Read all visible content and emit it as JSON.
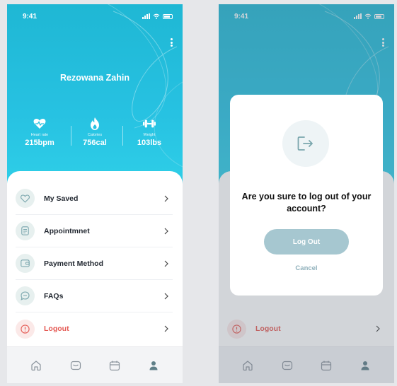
{
  "status": {
    "time": "9:41"
  },
  "profile": {
    "name": "Rezowana Zahin",
    "stats": [
      {
        "icon": "heart-rate-icon",
        "label": "Heart rate",
        "value": "215bpm"
      },
      {
        "icon": "calories-flame-icon",
        "label": "Calories",
        "value": "756cal"
      },
      {
        "icon": "dumbbell-icon",
        "label": "Weight",
        "value": "103lbs"
      }
    ]
  },
  "menu": {
    "items": [
      {
        "id": "my-saved",
        "label": "My Saved",
        "icon": "heart-icon"
      },
      {
        "id": "appointment",
        "label": "Appointmnet",
        "icon": "document-icon"
      },
      {
        "id": "payment-method",
        "label": "Payment Method",
        "icon": "wallet-icon"
      },
      {
        "id": "faqs",
        "label": "FAQs",
        "icon": "chat-icon"
      },
      {
        "id": "logout",
        "label": "Logout",
        "icon": "alert-icon"
      }
    ]
  },
  "tabbar": {
    "tabs": [
      {
        "id": "home",
        "icon": "home-icon"
      },
      {
        "id": "messages",
        "icon": "message-icon"
      },
      {
        "id": "calendar",
        "icon": "calendar-icon"
      },
      {
        "id": "profile",
        "icon": "user-icon",
        "active": true
      }
    ]
  },
  "logout_modal": {
    "title": "Are you sure to log out of your account?",
    "confirm_label": "Log Out",
    "cancel_label": "Cancel"
  },
  "colors": {
    "hero": "#27c2e2",
    "logout_text": "#e55b55",
    "primary_button": "#a6c7d0",
    "icon_teal": "#7aa6ad"
  }
}
